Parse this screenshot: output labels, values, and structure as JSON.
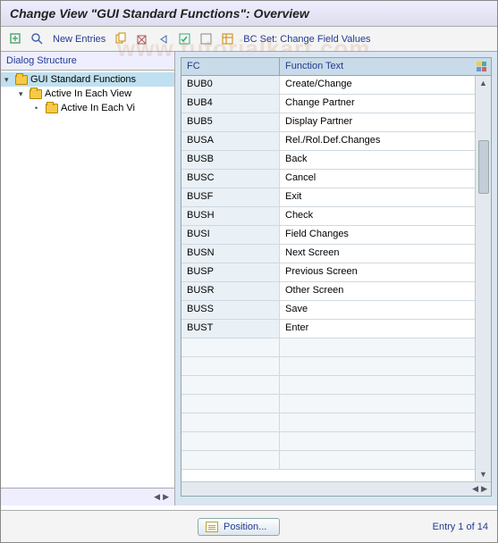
{
  "title": "Change View \"GUI Standard Functions\": Overview",
  "toolbar": {
    "new_entries": "New Entries",
    "bc_set": "BC Set: Change Field Values"
  },
  "sidebar": {
    "header": "Dialog Structure",
    "nodes": [
      {
        "label": "GUI Standard Functions",
        "level": 0,
        "selected": true,
        "expander": "▾"
      },
      {
        "label": "Active In Each View",
        "level": 1,
        "selected": false,
        "expander": "▾"
      },
      {
        "label": "Active In Each Vi",
        "level": 2,
        "selected": false,
        "expander": "•"
      }
    ]
  },
  "table": {
    "headers": {
      "fc": "FC",
      "ft": "Function Text"
    },
    "rows": [
      {
        "fc": "BUB0",
        "ft": "Create/Change"
      },
      {
        "fc": "BUB4",
        "ft": "Change Partner"
      },
      {
        "fc": "BUB5",
        "ft": "Display Partner"
      },
      {
        "fc": "BUSA",
        "ft": "Rel./Rol.Def.Changes"
      },
      {
        "fc": "BUSB",
        "ft": "Back"
      },
      {
        "fc": "BUSC",
        "ft": "Cancel"
      },
      {
        "fc": "BUSF",
        "ft": "Exit"
      },
      {
        "fc": "BUSH",
        "ft": "Check"
      },
      {
        "fc": "BUSI",
        "ft": "Field Changes"
      },
      {
        "fc": "BUSN",
        "ft": "Next Screen"
      },
      {
        "fc": "BUSP",
        "ft": "Previous Screen"
      },
      {
        "fc": "BUSR",
        "ft": "Other Screen"
      },
      {
        "fc": "BUSS",
        "ft": "Save"
      },
      {
        "fc": "BUST",
        "ft": "Enter"
      }
    ],
    "empty_rows": 7
  },
  "footer": {
    "position": "Position...",
    "entry_info": "Entry 1 of 14"
  },
  "watermark": "www.tutorialkart.com"
}
